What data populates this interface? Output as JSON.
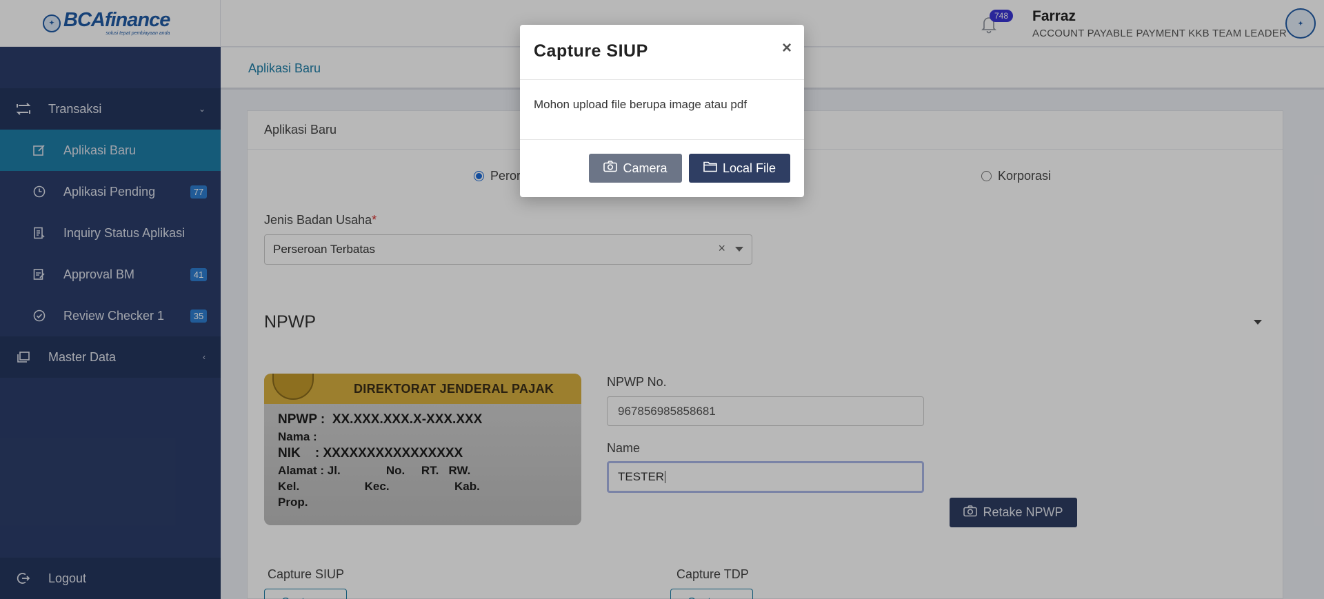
{
  "brand": {
    "name": "BCAfinance",
    "tagline": "solusi tepat pembiayaan anda"
  },
  "header": {
    "notification_count": "748",
    "user_name": "Farraz",
    "user_role": "ACCOUNT PAYABLE PAYMENT KKB TEAM LEADER"
  },
  "sidebar": {
    "groups": [
      {
        "label": "Transaksi"
      },
      {
        "label": "Master Data"
      }
    ],
    "items": [
      {
        "label": "Aplikasi Baru",
        "badge": ""
      },
      {
        "label": "Aplikasi Pending",
        "badge": "77"
      },
      {
        "label": "Inquiry Status Aplikasi",
        "badge": ""
      },
      {
        "label": "Approval BM",
        "badge": "41"
      },
      {
        "label": "Review Checker 1",
        "badge": "35"
      }
    ],
    "logout_label": "Logout"
  },
  "breadcrumb": "Aplikasi Baru",
  "form": {
    "card_title": "Aplikasi Baru",
    "type_options": [
      "Perorangan",
      "Korporasi"
    ],
    "selected_type": "Perorangan",
    "jenis_label": "Jenis Badan Usaha",
    "jenis_required": "*",
    "jenis_value": "Perseroan Terbatas",
    "npwp_section": "NPWP",
    "npwp_no_label": "NPWP No.",
    "npwp_no_value": "967856985858681",
    "name_label": "Name",
    "name_value": "TESTER",
    "retake_label": "Retake NPWP",
    "capture_siup_label": "Capture SIUP",
    "capture_tdp_label": "Capture TDP",
    "capture_button_label": "Capture"
  },
  "npwp_card": {
    "header": "DIREKTORAT JENDERAL PAJAK",
    "lines": [
      "NPWP :  XX.XXX.XXX.X-XXX.XXX",
      "Nama :",
      "NIK    : XXXXXXXXXXXXXXXX",
      "Alamat : Jl.              No.     RT.   RW.",
      "Kel.                    Kec.                    Kab.",
      "Prop."
    ]
  },
  "modal": {
    "title": "Capture SIUP",
    "close": "×",
    "message": "Mohon upload file berupa image atau pdf",
    "camera_label": "Camera",
    "local_file_label": "Local File"
  }
}
